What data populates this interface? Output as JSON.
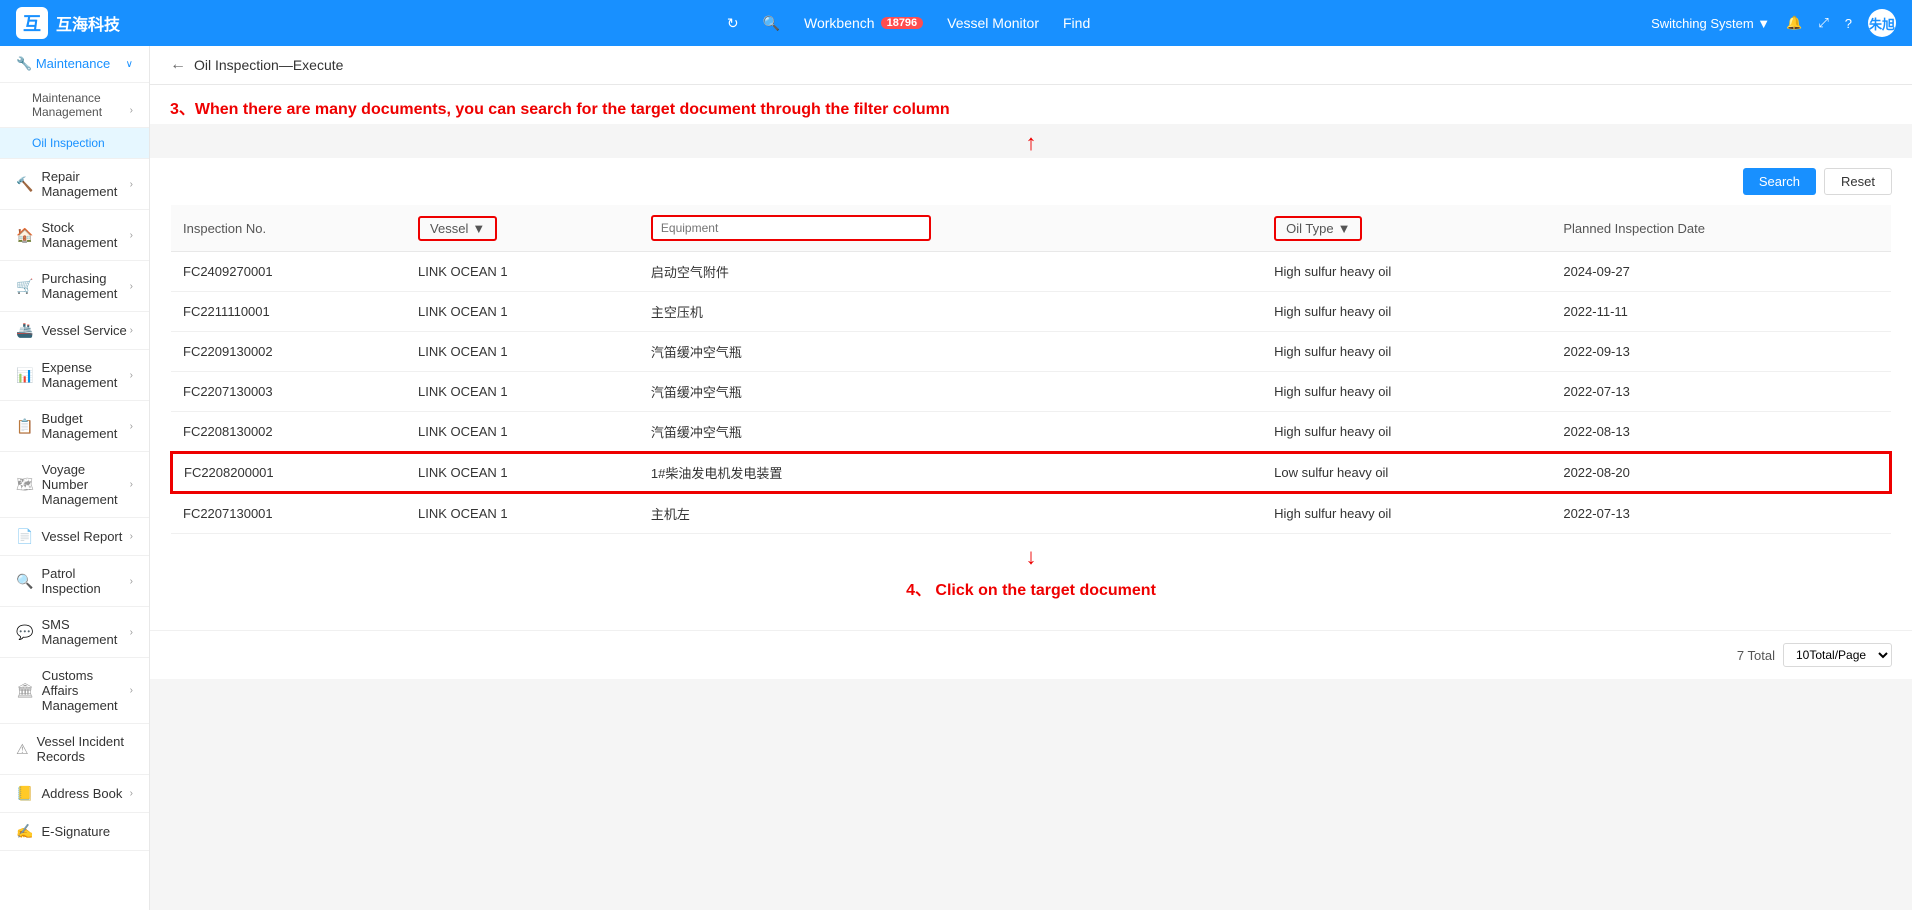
{
  "app": {
    "logo_text": "互海科技",
    "logo_icon": "互"
  },
  "top_nav": {
    "workbench_label": "Workbench",
    "workbench_badge": "18796",
    "vessel_monitor_label": "Vessel Monitor",
    "find_label": "Find",
    "switching_system_label": "Switching System",
    "user_name": "朱旭"
  },
  "sidebar": {
    "maintenance_label": "Maintenance",
    "maintenance_management_label": "Maintenance Management",
    "oil_inspection_label": "Oil Inspection",
    "repair_management_label": "Repair Management",
    "stock_management_label": "Stock Management",
    "purchasing_management_label": "Purchasing Management",
    "vessel_service_label": "Vessel Service",
    "expense_management_label": "Expense Management",
    "budget_management_label": "Budget Management",
    "voyage_number_management_label": "Voyage Number Management",
    "vessel_report_label": "Vessel Report",
    "patrol_inspection_label": "Patrol Inspection",
    "sms_management_label": "SMS Management",
    "customs_affairs_management_label": "Customs Affairs Management",
    "vessel_incident_records_label": "Vessel Incident Records",
    "address_book_label": "Address Book",
    "e_signature_label": "E-Signature"
  },
  "page": {
    "back_label": "←",
    "title": "Oil Inspection—Execute",
    "annotation_top": "3、When there are many documents, you can search for the target document through the filter column",
    "annotation_bottom": "4、 Click on the target document"
  },
  "toolbar": {
    "search_label": "Search",
    "reset_label": "Reset"
  },
  "table": {
    "col_inspection_no": "Inspection No.",
    "col_vessel": "Vessel",
    "col_equipment": "Equipment",
    "col_oil_type": "Oil Type",
    "col_planned_date": "Planned Inspection Date",
    "filter_vessel_placeholder": "Vessel",
    "filter_equipment_placeholder": "Equipment",
    "filter_oil_type_placeholder": "Oil Type",
    "rows": [
      {
        "inspection_no": "FC2409270001",
        "vessel": "LINK OCEAN 1",
        "equipment": "启动空气附件",
        "oil_type": "High sulfur heavy oil",
        "planned_date": "2024-09-27",
        "highlighted": false
      },
      {
        "inspection_no": "FC2211110001",
        "vessel": "LINK OCEAN 1",
        "equipment": "主空压机",
        "oil_type": "High sulfur heavy oil",
        "planned_date": "2022-11-11",
        "highlighted": false
      },
      {
        "inspection_no": "FC2209130002",
        "vessel": "LINK OCEAN 1",
        "equipment": "汽笛缓冲空气瓶",
        "oil_type": "High sulfur heavy oil",
        "planned_date": "2022-09-13",
        "highlighted": false
      },
      {
        "inspection_no": "FC2207130003",
        "vessel": "LINK OCEAN 1",
        "equipment": "汽笛缓冲空气瓶",
        "oil_type": "High sulfur heavy oil",
        "planned_date": "2022-07-13",
        "highlighted": false
      },
      {
        "inspection_no": "FC2208130002",
        "vessel": "LINK OCEAN 1",
        "equipment": "汽笛缓冲空气瓶",
        "oil_type": "High sulfur heavy oil",
        "planned_date": "2022-08-13",
        "highlighted": false
      },
      {
        "inspection_no": "FC2208200001",
        "vessel": "LINK OCEAN 1",
        "equipment": "1#柴油发电机发电装置",
        "oil_type": "Low sulfur heavy oil",
        "planned_date": "2022-08-20",
        "highlighted": true
      },
      {
        "inspection_no": "FC2207130001",
        "vessel": "LINK OCEAN 1",
        "equipment": "主机左",
        "oil_type": "High sulfur heavy oil",
        "planned_date": "2022-07-13",
        "highlighted": false
      }
    ],
    "total_label": "7 Total",
    "page_size_label": "10Total/Page"
  },
  "icons": {
    "back": "←",
    "chevron_right": "›",
    "chevron_down": "∨",
    "dropdown": "▼",
    "bell": "🔔",
    "expand": "⤢",
    "question": "?",
    "search": "🔍",
    "refresh": "↻"
  }
}
